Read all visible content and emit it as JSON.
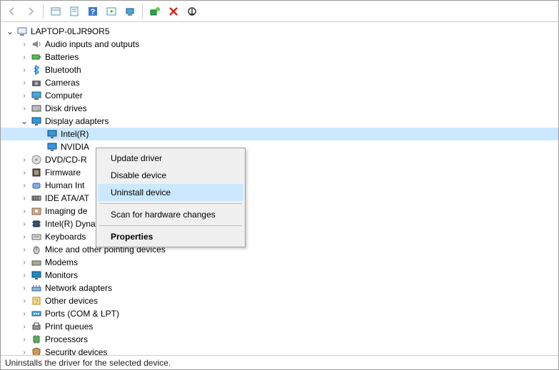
{
  "toolbar": [
    {
      "name": "back-arrow-icon",
      "enabled": false
    },
    {
      "name": "forward-arrow-icon",
      "enabled": false
    },
    {
      "name": "sep"
    },
    {
      "name": "show-hidden-icon",
      "enabled": true
    },
    {
      "name": "properties-icon",
      "enabled": true
    },
    {
      "name": "help-icon",
      "enabled": true
    },
    {
      "name": "action-icon",
      "enabled": true
    },
    {
      "name": "scan-icon",
      "enabled": true
    },
    {
      "name": "sep"
    },
    {
      "name": "add-legacy-icon",
      "enabled": true
    },
    {
      "name": "remove-icon",
      "enabled": true
    },
    {
      "name": "update-icon",
      "enabled": true
    }
  ],
  "root": {
    "label": "LAPTOP-0LJR9OR5",
    "icon": "computer",
    "expanded": true
  },
  "categories": [
    {
      "label": "Audio inputs and outputs",
      "icon": "audio",
      "exp": ">"
    },
    {
      "label": "Batteries",
      "icon": "battery",
      "exp": ">"
    },
    {
      "label": "Bluetooth",
      "icon": "bluetooth",
      "exp": ">"
    },
    {
      "label": "Cameras",
      "icon": "camera",
      "exp": ">"
    },
    {
      "label": "Computer",
      "icon": "computer-filled",
      "exp": ">"
    },
    {
      "label": "Disk drives",
      "icon": "disk",
      "exp": ">"
    },
    {
      "label": "Display adapters",
      "icon": "display",
      "exp": "v",
      "children": [
        {
          "label": "Intel(R)",
          "icon": "display",
          "selected": true
        },
        {
          "label": "NVIDIA",
          "icon": "display"
        }
      ]
    },
    {
      "label": "DVD/CD-R",
      "icon": "dvd",
      "exp": ">",
      "truncated": true
    },
    {
      "label": "Firmware",
      "icon": "firmware",
      "exp": ">"
    },
    {
      "label": "Human Int",
      "icon": "hid",
      "exp": ">",
      "truncated": true
    },
    {
      "label": "IDE ATA/AT",
      "icon": "ide",
      "exp": ">",
      "truncated": true
    },
    {
      "label": "Imaging de",
      "icon": "imaging",
      "exp": ">",
      "truncated": true
    },
    {
      "label": "Intel(R) Dynamic Platform and Thermal Framework",
      "icon": "chip",
      "exp": ">"
    },
    {
      "label": "Keyboards",
      "icon": "keyboard",
      "exp": ">"
    },
    {
      "label": "Mice and other pointing devices",
      "icon": "mouse",
      "exp": ">"
    },
    {
      "label": "Modems",
      "icon": "modem",
      "exp": ">"
    },
    {
      "label": "Monitors",
      "icon": "monitor",
      "exp": ">"
    },
    {
      "label": "Network adapters",
      "icon": "network",
      "exp": ">"
    },
    {
      "label": "Other devices",
      "icon": "other",
      "exp": ">"
    },
    {
      "label": "Ports (COM & LPT)",
      "icon": "port",
      "exp": ">"
    },
    {
      "label": "Print queues",
      "icon": "printer",
      "exp": ">"
    },
    {
      "label": "Processors",
      "icon": "cpu",
      "exp": ">"
    },
    {
      "label": "Security devices",
      "icon": "security",
      "exp": ">"
    }
  ],
  "context_menu": {
    "items": [
      {
        "label": "Update driver",
        "hl": false
      },
      {
        "label": "Disable device",
        "hl": false
      },
      {
        "label": "Uninstall device",
        "hl": true,
        "boxed": true
      },
      {
        "sep": true
      },
      {
        "label": "Scan for hardware changes",
        "hl": false
      },
      {
        "sep": true
      },
      {
        "label": "Properties",
        "hl": false,
        "bold": true
      }
    ]
  },
  "status_text": "Uninstalls the driver for the selected device."
}
